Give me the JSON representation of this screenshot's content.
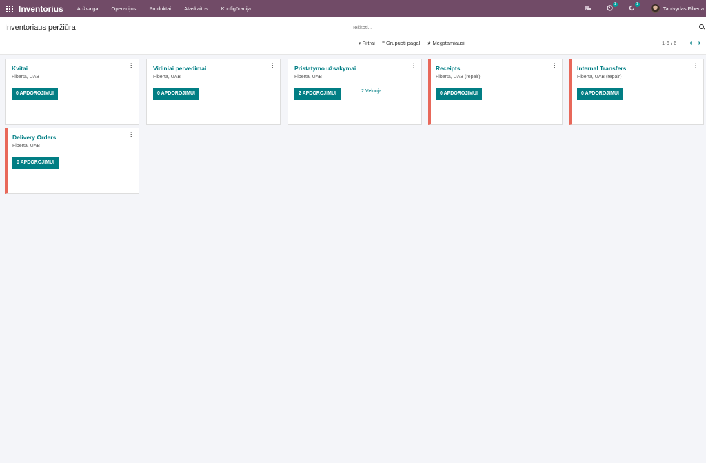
{
  "navbar": {
    "brand": "Inventorius",
    "menu": [
      "Apžvalga",
      "Operacijos",
      "Produktai",
      "Ataskaitos",
      "Konfigūracija"
    ],
    "messages_badge": "",
    "activity_badge": "1",
    "clock_badge": "1",
    "user_name": "Tautvydas Fiberta",
    "colors": {
      "navbar_bg": "#714b67",
      "accent": "#017e84",
      "alert": "#e8685a"
    }
  },
  "control": {
    "title": "Inventoriaus peržiūra",
    "search_placeholder": "Ieškoti...",
    "filters_label": "Filtrai",
    "group_label": "Grupuoti pagal",
    "favorites_label": "Mėgstamiausi",
    "pager": "1-6 / 6"
  },
  "cards": [
    {
      "title": "Kvitai",
      "company": "Fiberta, UAB",
      "button": "0 APDOROJIMUI",
      "link": ""
    },
    {
      "title": "Vidiniai pervedimai",
      "company": "Fiberta, UAB",
      "button": "0 APDOROJIMUI",
      "link": ""
    },
    {
      "title": "Pristatymo užsakymai",
      "company": "Fiberta, UAB",
      "button": "2 APDOROJIMUI",
      "link": "2 Vėluoja"
    },
    {
      "title": "Receipts",
      "company": "Fiberta, UAB (repair)",
      "button": "0 APDOROJIMUI",
      "link": ""
    },
    {
      "title": "Internal Transfers",
      "company": "Fiberta, UAB (repair)",
      "button": "0 APDOROJIMUI",
      "link": ""
    },
    {
      "title": "Delivery Orders",
      "company": "Fiberta, UAB",
      "button": "0 APDOROJIMUI",
      "link": ""
    }
  ]
}
